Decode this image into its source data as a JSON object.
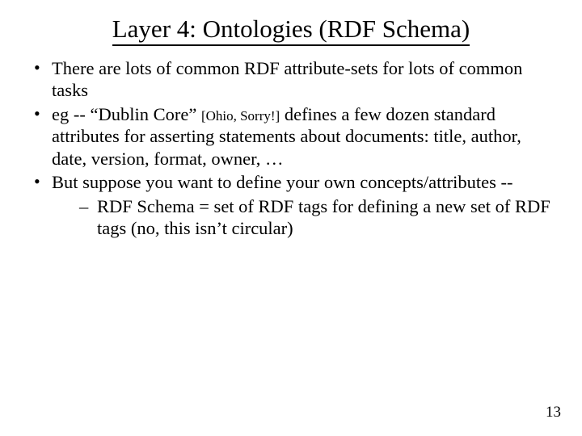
{
  "title": "Layer 4: Ontologies (RDF Schema)",
  "bullets": {
    "b1": "There are lots of common RDF attribute-sets for lots of common tasks",
    "b2_pre": "eg -- “Dublin Core” ",
    "b2_small": "[Ohio, Sorry!]",
    "b2_post": " defines a few dozen standard attributes for asserting statements about documents: title, author, date, version, format, owner, …",
    "b3": "But suppose you want to define your own concepts/attributes --",
    "b3_sub": "RDF Schema = set of RDF tags for defining a new set of RDF tags  (no, this isn’t circular)"
  },
  "page_number": "13"
}
